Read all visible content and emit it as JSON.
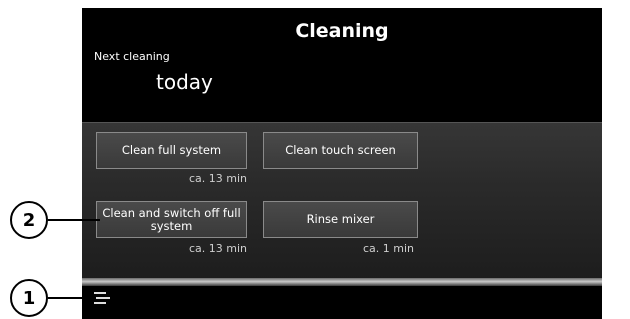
{
  "screen": {
    "title": "Cleaning",
    "next_cleaning_label": "Next cleaning",
    "next_cleaning_value": "today"
  },
  "buttons": [
    {
      "label": "Clean full system",
      "duration": "ca. 13 min"
    },
    {
      "label": "Clean touch screen",
      "duration": ""
    },
    {
      "label": "Clean and switch off full system",
      "duration": "ca. 13 min"
    },
    {
      "label": "Rinse mixer",
      "duration": "ca. 1 min"
    }
  ],
  "callouts": {
    "menu": "1",
    "clean_switch_off": "2"
  },
  "figure_id": "000564",
  "icons": {
    "menu": "menu-icon"
  }
}
